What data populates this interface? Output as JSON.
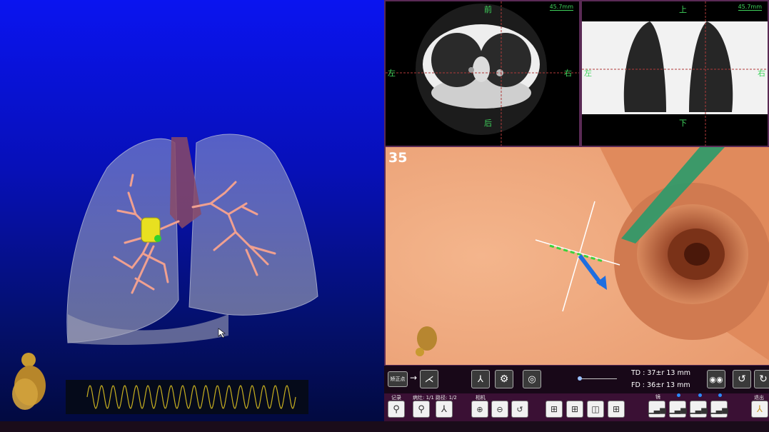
{
  "views": {
    "axial": {
      "orient_top": "前",
      "orient_bottom": "后",
      "orient_left": "左",
      "orient_right": "右",
      "scale": "45.7mm"
    },
    "coronal": {
      "orient_top": "上",
      "orient_bottom": "下",
      "orient_left": "左",
      "orient_right": "右",
      "scale": "45.7mm"
    },
    "endoscopic": {
      "frame_number": "35"
    }
  },
  "toolbar": {
    "correct_button": "矫正点",
    "measurements": {
      "td": "TD :   37±r 13 mm",
      "fd": "FD :   36±r 13 mm"
    },
    "group_labels": {
      "record": "记录",
      "pointer_count": "病灶: 1/1",
      "path_count": "路径: 1/2",
      "camera": "相机",
      "light": "镜",
      "exit": "退出"
    }
  },
  "colors": {
    "accent_green": "#3fd45c",
    "frame_border": "#5a2a55",
    "toolbar_bg": "#3a1034"
  }
}
